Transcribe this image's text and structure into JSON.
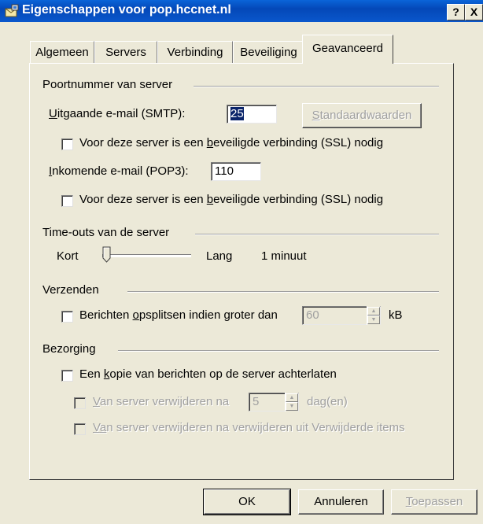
{
  "window": {
    "title": "Eigenschappen voor pop.hccnet.nl",
    "help_label": "?",
    "close_label": "X"
  },
  "tabs": [
    {
      "label": "Algemeen"
    },
    {
      "label": "Servers"
    },
    {
      "label": "Verbinding"
    },
    {
      "label": "Beveiliging"
    },
    {
      "label": "Geavanceerd"
    }
  ],
  "ports": {
    "group_label": "Poortnummer van server",
    "smtp_prefix": "U",
    "smtp_rest": "itgaande e-mail (SMTP):",
    "smtp_value": "25",
    "defaults_prefix": "S",
    "defaults_rest": "tandaardwaarden",
    "ssl_a": "Voor deze server is een ",
    "ssl_b": "b",
    "ssl_c": "eveiligde verbinding (SSL) nodig",
    "pop3_prefix": "I",
    "pop3_rest": "nkomende e-mail (POP3):",
    "pop3_value": "110"
  },
  "timeouts": {
    "group_label": "Time-outs van de server",
    "short_label": "Kort",
    "long_label": "Lang",
    "value_label": "1 minuut",
    "level_fraction": 0.0
  },
  "sending": {
    "group_label": "Verzenden",
    "split_a": "Berichten ",
    "split_b": "o",
    "split_c": "psplitsen indien groter dan",
    "split_value": "60",
    "unit": "kB"
  },
  "delivery": {
    "group_label": "Bezorging",
    "keep_a": "Een ",
    "keep_b": "k",
    "keep_c": "opie van berichten op de server achterlaten",
    "remove_a": "V",
    "remove_b": "an server verwijderen na",
    "remove_value": "5",
    "remove_unit": "dag(en)",
    "remove2_a": "V",
    "remove2_b": "a",
    "remove2_c": "n server verwijderen na verwijderen uit Verwijderde items"
  },
  "buttons": {
    "ok": "OK",
    "cancel": "Annuleren",
    "apply_a": "T",
    "apply_b": "oepassen"
  }
}
